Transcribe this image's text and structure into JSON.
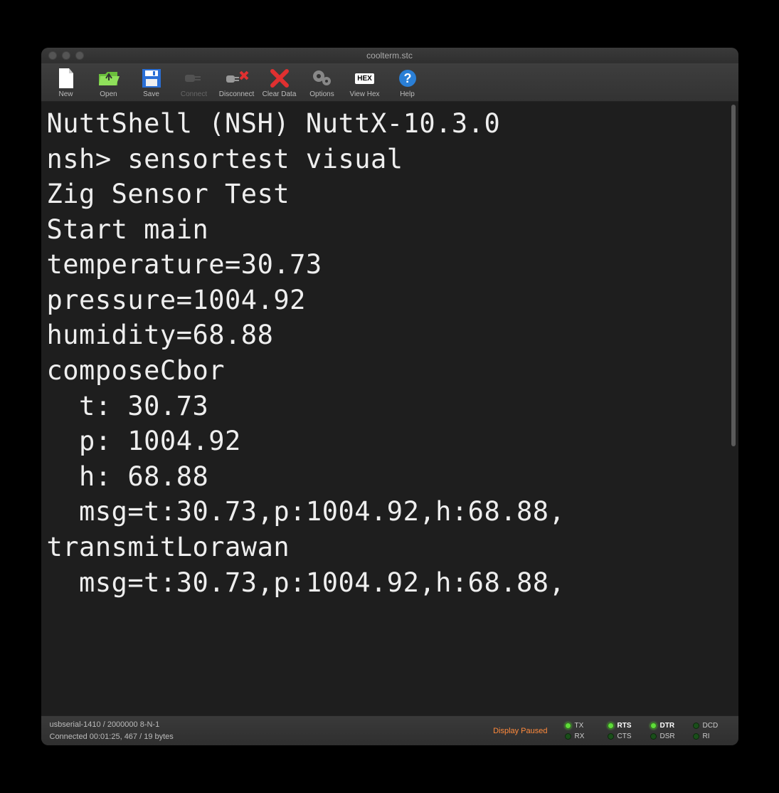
{
  "window": {
    "title": "coolterm.stc"
  },
  "toolbar": {
    "new": "New",
    "open": "Open",
    "save": "Save",
    "connect": "Connect",
    "disconnect": "Disconnect",
    "clear": "Clear Data",
    "options": "Options",
    "viewhex": "View Hex",
    "viewhex_icon_text": "HEX",
    "help": "Help"
  },
  "terminal": {
    "lines": [
      "NuttShell (NSH) NuttX-10.3.0",
      "nsh> sensortest visual",
      "Zig Sensor Test",
      "Start main",
      "temperature=30.73",
      "pressure=1004.92",
      "humidity=68.88",
      "composeCbor",
      "  t: 30.73",
      "  p: 1004.92",
      "  h: 68.88",
      "  msg=t:30.73,p:1004.92,h:68.88,",
      "transmitLorawan",
      "  msg=t:30.73,p:1004.92,h:68.88,"
    ]
  },
  "status": {
    "line1": "usbserial-1410 / 2000000 8-N-1",
    "line2": "Connected 00:01:25, 467 / 19 bytes",
    "paused": "Display Paused",
    "tx": "TX",
    "rx": "RX",
    "rts": "RTS",
    "cts": "CTS",
    "dtr": "DTR",
    "dsr": "DSR",
    "dcd": "DCD",
    "ri": "RI"
  }
}
